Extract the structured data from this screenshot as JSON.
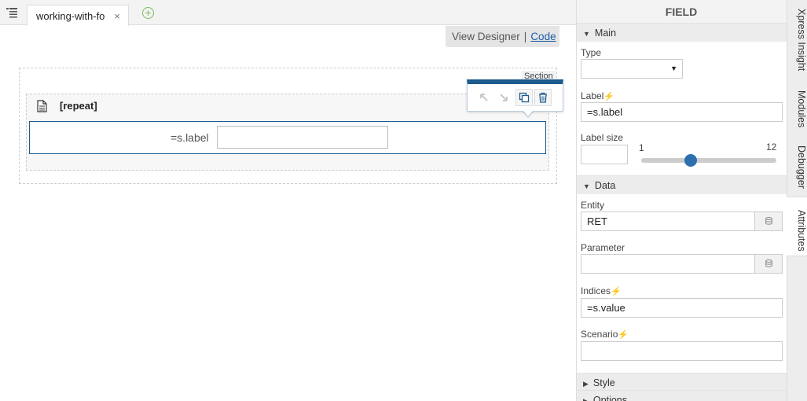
{
  "tabbar": {
    "file_tab_label": "working-with-fo",
    "close_glyph": "×",
    "add_glyph": "+"
  },
  "view_switch": {
    "designer": "View Designer",
    "separator": "|",
    "code": "Code"
  },
  "canvas": {
    "section_label": "Section",
    "repeat_title": "[repeat]",
    "field_label": "=s.label"
  },
  "panel": {
    "title": "FIELD",
    "groups": {
      "main": "Main",
      "data": "Data",
      "style": "Style",
      "options": "Options"
    },
    "fields": {
      "type_label": "Type",
      "type_value": "",
      "label_label": "Label",
      "label_value": "=s.label",
      "label_size_label": "Label size",
      "label_size_min": "1",
      "label_size_max": "12",
      "label_size_value": 5,
      "entity_label": "Entity",
      "entity_value": "RET",
      "parameter_label": "Parameter",
      "parameter_value": "",
      "indices_label": "Indices",
      "indices_value": "=s.value",
      "scenario_label": "Scenario",
      "scenario_value": ""
    }
  },
  "side_tabs": [
    "Xpress Insight",
    "Modules",
    "Debugger",
    "Attributes"
  ],
  "active_side_tab": "Attributes",
  "colors": {
    "accent": "#1d5b8e",
    "slider_thumb": "#2c6fad",
    "bolt": "#f0a000",
    "add_icon": "#7bbf5a"
  }
}
